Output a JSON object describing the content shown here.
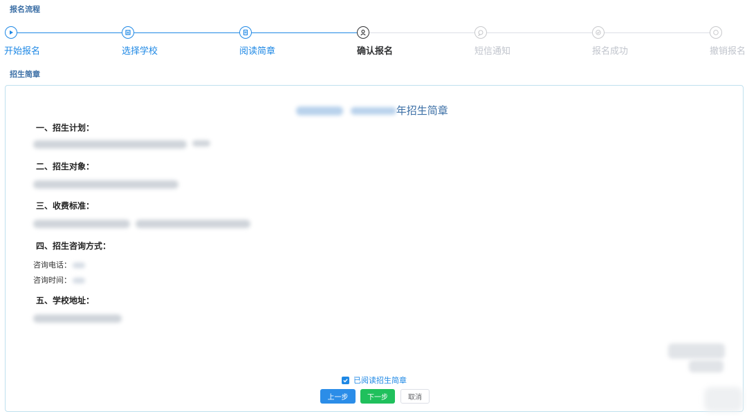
{
  "section_titles": {
    "flow": "报名流程",
    "brochure": "招生简章"
  },
  "stepper": {
    "steps": [
      {
        "label": "开始报名",
        "status": "done",
        "icon": "play-icon"
      },
      {
        "label": "选择学校",
        "status": "done",
        "icon": "school-icon"
      },
      {
        "label": "阅读简章",
        "status": "done",
        "icon": "document-icon"
      },
      {
        "label": "确认报名",
        "status": "current",
        "icon": "user-icon"
      },
      {
        "label": "短信通知",
        "status": "todo",
        "icon": "message-icon"
      },
      {
        "label": "报名成功",
        "status": "todo",
        "icon": "check-icon"
      },
      {
        "label": "撤销报名",
        "status": "todo",
        "icon": "cancel-icon"
      }
    ]
  },
  "document": {
    "title_suffix": "年招生简章",
    "sections": [
      {
        "heading": "一、招生计划："
      },
      {
        "heading": "二、招生对象："
      },
      {
        "heading": "三、收费标准："
      },
      {
        "heading": "四、招生咨询方式：",
        "items": [
          "咨询电话：",
          "咨询时间："
        ]
      },
      {
        "heading": "五、学校地址："
      }
    ]
  },
  "agreement": {
    "checked": true,
    "label": "已阅读招生简章"
  },
  "buttons": {
    "prev": "上一步",
    "next": "下一步",
    "cancel": "取消"
  },
  "colors": {
    "accent": "#1e88e5",
    "success": "#20c05c",
    "current_step": "#303133",
    "inactive": "#c0c4cc"
  }
}
